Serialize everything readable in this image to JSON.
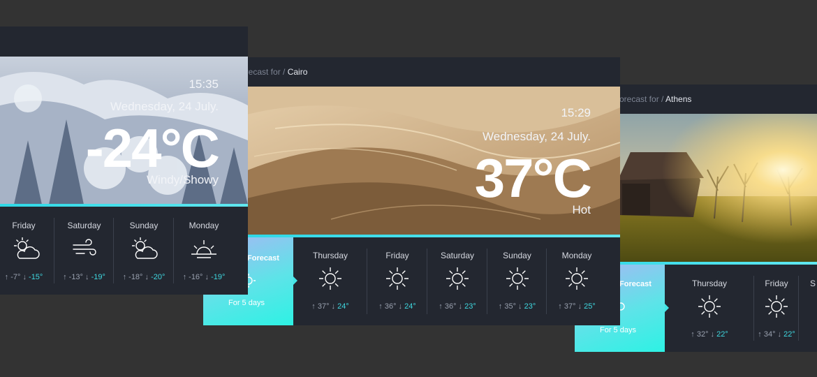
{
  "cards": {
    "snow": {
      "time": "15:35",
      "date": "Wednesday, 24 July.",
      "temperature": "-24°C",
      "condition": "Windy/Showy",
      "days": [
        {
          "name": "Friday",
          "icon": "partly-cloudy-icon",
          "low": "-7°",
          "high": "-15°"
        },
        {
          "name": "Saturday",
          "icon": "wind-icon",
          "low": "-13°",
          "high": "-19°"
        },
        {
          "name": "Sunday",
          "icon": "partly-cloudy-icon",
          "low": "-18°",
          "high": "-20°"
        },
        {
          "name": "Monday",
          "icon": "sunrise-icon",
          "low": "-16°",
          "high": "-19°"
        }
      ]
    },
    "cairo": {
      "crumb_prefix": "orecast for / ",
      "city": "Cairo",
      "time": "15:29",
      "date": "Wednesday, 24 July.",
      "temperature": "37°C",
      "condition": "Hot",
      "tab_title": "Forecast",
      "tab_sub": "For 5 days",
      "days": [
        {
          "name": "Thursday",
          "icon": "sun-icon",
          "low": "37°",
          "high": "24°"
        },
        {
          "name": "Friday",
          "icon": "sun-icon",
          "low": "36°",
          "high": "24°"
        },
        {
          "name": "Saturday",
          "icon": "sun-icon",
          "low": "36°",
          "high": "23°"
        },
        {
          "name": "Sunday",
          "icon": "sun-icon",
          "low": "35°",
          "high": "23°"
        },
        {
          "name": "Monday",
          "icon": "sun-icon",
          "low": "37°",
          "high": "25°"
        }
      ]
    },
    "athens": {
      "crumb_prefix": "orecast for / ",
      "city": "Athens",
      "tab_title": "Forecast",
      "tab_sub": "For 5 days",
      "days": [
        {
          "name": "Thursday",
          "icon": "sun-icon",
          "low": "32°",
          "high": "22°"
        },
        {
          "name": "Friday",
          "icon": "sun-icon",
          "low": "34°",
          "high": "22°"
        },
        {
          "name": "S",
          "icon": "sun-icon",
          "low": "",
          "high": ""
        }
      ]
    }
  },
  "colors": {
    "background": "#333333",
    "card": "#232730",
    "accent": "#3fd8e0"
  }
}
